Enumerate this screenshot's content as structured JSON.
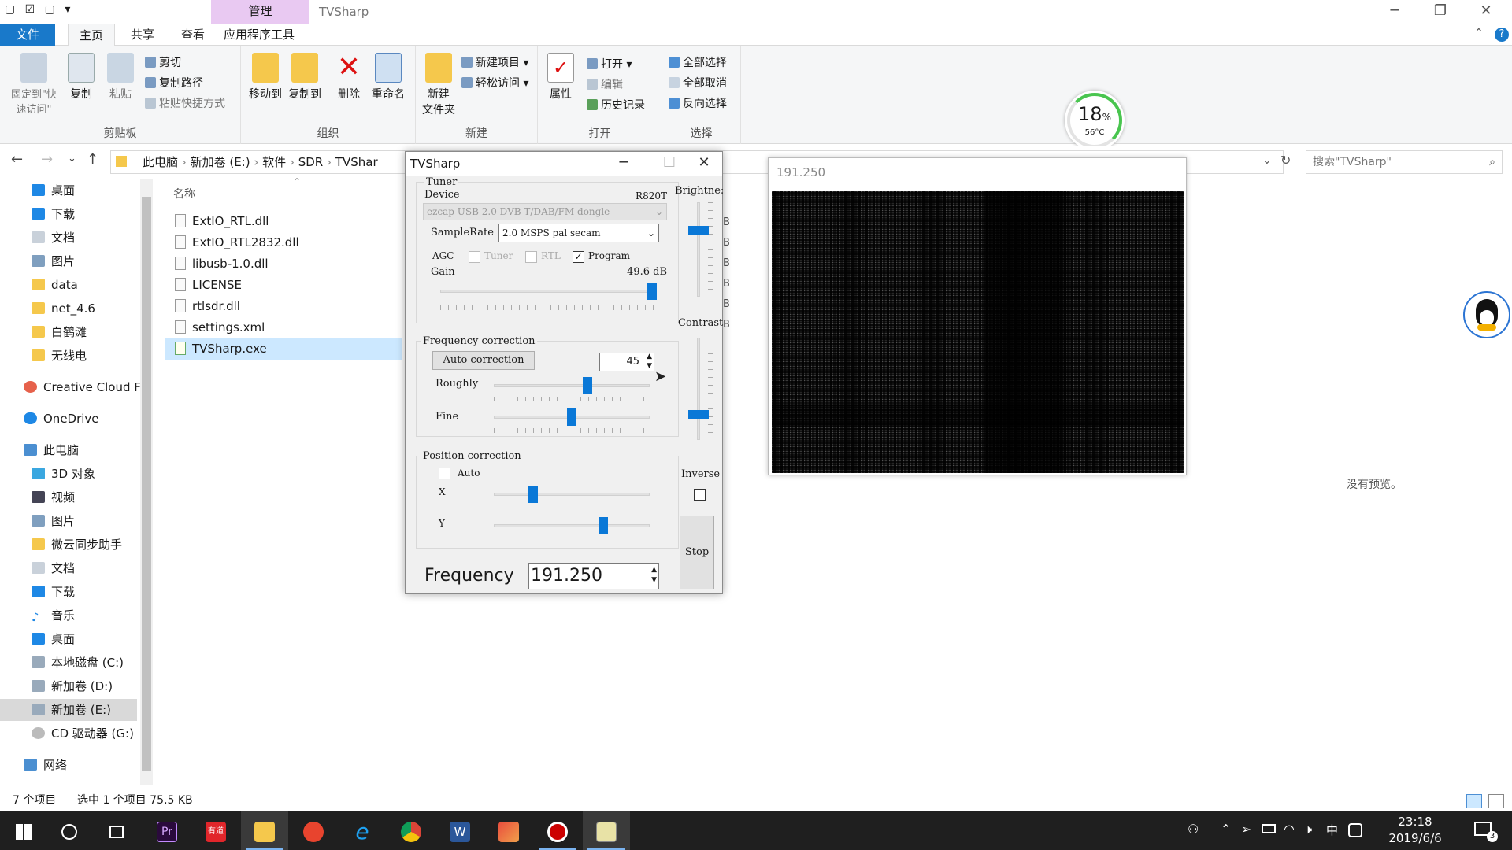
{
  "explorer": {
    "quick_access_glyphs": "▢ ☑ ▢ ▾",
    "context_tab": "管理",
    "window_title": "TVSharp",
    "tabs": [
      "文件",
      "主页",
      "共享",
      "查看",
      "应用程序工具"
    ],
    "ribbon": {
      "clipboard": {
        "label": "剪贴板",
        "pin": "固定到\"快速访问\"",
        "copy": "复制",
        "paste": "粘贴",
        "cut": "剪切",
        "copy_path": "复制路径",
        "paste_shortcut": "粘贴快捷方式"
      },
      "organize": {
        "label": "组织",
        "move_to": "移动到",
        "copy_to": "复制到",
        "delete": "删除",
        "rename": "重命名"
      },
      "new": {
        "label": "新建",
        "new_folder": "新建\n文件夹",
        "new_item": "新建项目",
        "easy_access": "轻松访问"
      },
      "open": {
        "label": "打开",
        "properties": "属性",
        "open": "打开",
        "edit": "编辑",
        "history": "历史记录"
      },
      "select": {
        "label": "选择",
        "select_all": "全部选择",
        "select_none": "全部取消",
        "invert": "反向选择"
      }
    },
    "breadcrumb": [
      "此电脑",
      "新加卷 (E:)",
      "软件",
      "SDR",
      "TVShar"
    ],
    "search_placeholder": "搜索\"TVSharp\"",
    "column_name": "名称",
    "nav_items": [
      "桌面",
      "下载",
      "文档",
      "图片",
      "data",
      "net_4.6",
      "白鹤滩",
      "无线电",
      "Creative Cloud F",
      "OneDrive",
      "此电脑",
      "3D 对象",
      "视频",
      "图片",
      "微云同步助手",
      "文档",
      "下载",
      "音乐",
      "桌面",
      "本地磁盘 (C:)",
      "新加卷 (D:)",
      "新加卷 (E:)",
      "CD 驱动器 (G:)",
      "网络"
    ],
    "files": [
      "ExtIO_RTL.dll",
      "ExtIO_RTL2832.dll",
      "libusb-1.0.dll",
      "LICENSE",
      "rtlsdr.dll",
      "settings.xml",
      "TVSharp.exe"
    ],
    "status_count": "7 个项目",
    "status_selected": "选中 1 个项目  75.5 KB",
    "no_preview": "没有预览。",
    "partial_letters": "B"
  },
  "temperature": {
    "percent": "18",
    "percent_unit": "%",
    "celsius": "56°C"
  },
  "tvsharp": {
    "title": "TVSharp",
    "tuner_label": "Tuner",
    "device_label": "Device",
    "device_model": "R820T",
    "device_value": "ezcap USB 2.0 DVB-T/DAB/FM dongle",
    "samplerate_label": "SampleRate",
    "samplerate_value": "2.0 MSPS pal secam",
    "agc_label": "AGC",
    "agc_tuner": "Tuner",
    "agc_rtl": "RTL",
    "agc_program": "Program",
    "gain_label": "Gain",
    "gain_value": "49.6 dB",
    "gain_level": 0.98,
    "freqcorr_label": "Frequency correction",
    "auto_correction": "Auto correction",
    "correction_value": "45",
    "roughly_label": "Roughly",
    "roughly_level": 0.6,
    "fine_label": "Fine",
    "fine_level": 0.5,
    "poscorr_label": "Position correction",
    "auto_label": "Auto",
    "x_label": "X",
    "x_level": 0.25,
    "y_label": "Y",
    "y_level": 0.7,
    "brightness_label": "Brightne:",
    "brightness_level": 0.7,
    "contrast_label": "Contrast",
    "contrast_level": 0.25,
    "inverse_label": "Inverse",
    "stop_label": "Stop",
    "frequency_label": "Frequency",
    "frequency_value": "191.250"
  },
  "video_window": {
    "title": "191.250"
  },
  "taskbar": {
    "time": "23:18",
    "date": "2019/6/6",
    "ime": "中",
    "notifications": "3",
    "app_letter_pr": "Pr",
    "app_letter_youdao": "有道",
    "app_letter_word": "W"
  }
}
